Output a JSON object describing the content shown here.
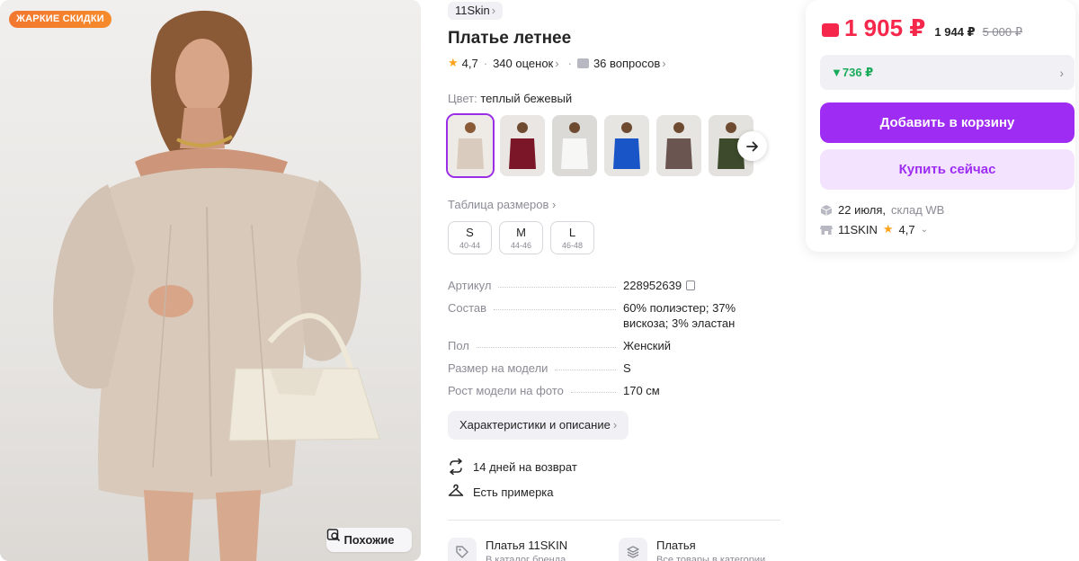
{
  "photo": {
    "sale_badge": "ЖАРКИЕ СКИДКИ",
    "similar_label": "Похожие"
  },
  "product": {
    "brand": "11Skin",
    "title": "Платье летнее",
    "rating": "4,7",
    "reviews": "340 оценок",
    "questions": "36 вопросов",
    "color_label": "Цвет:",
    "color_value": "теплый бежевый",
    "swatch_colors": [
      "#d9cbbd",
      "#7a1628",
      "#f2f2f0",
      "#1a55c8",
      "#6b5550",
      "#3d4a2c"
    ],
    "size_table_link": "Таблица размеров",
    "sizes": [
      {
        "size": "S",
        "range": "40-44"
      },
      {
        "size": "M",
        "range": "44-46"
      },
      {
        "size": "L",
        "range": "46-48"
      }
    ],
    "specs": [
      {
        "key": "Артикул",
        "value": "228952639"
      },
      {
        "key": "Состав",
        "value": "60% полиэстер; 37% вискоза; 3% эластан"
      },
      {
        "key": "Пол",
        "value": "Женский"
      },
      {
        "key": "Размер на модели",
        "value": "S"
      },
      {
        "key": "Рост модели на фото",
        "value": "170 см"
      }
    ],
    "description_button": "Характеристики и описание",
    "perks": [
      "14 дней на возврат",
      "Есть примерка"
    ],
    "bottom_links": [
      {
        "title": "Платья 11SKIN",
        "subtitle": "В каталог бренда"
      },
      {
        "title": "Платья",
        "subtitle": "Все товары в категории"
      }
    ]
  },
  "buy": {
    "price": "1 905 ₽",
    "price_wallet": "1 944 ₽",
    "price_old": "5 000 ₽",
    "cashback": "▼736 ₽",
    "add_to_cart": "Добавить в корзину",
    "buy_now": "Купить сейчас",
    "delivery_date": "22 июля,",
    "delivery_warehouse": "склад WB",
    "seller_name": "11SKIN",
    "seller_rating": "4,7"
  },
  "colors": {
    "accent": "#9e2cf3",
    "price": "#f5284b",
    "cashback": "#1aab5a",
    "sale_badge": "#f2772f",
    "star": "#ffa31a"
  },
  "icons": [
    "search-image-icon",
    "star-icon",
    "question-icon",
    "arrow-right-icon",
    "copy-icon",
    "return-icon",
    "hanger-icon",
    "tag-icon",
    "stack-icon",
    "wallet-icon",
    "box-icon",
    "shop-icon"
  ]
}
